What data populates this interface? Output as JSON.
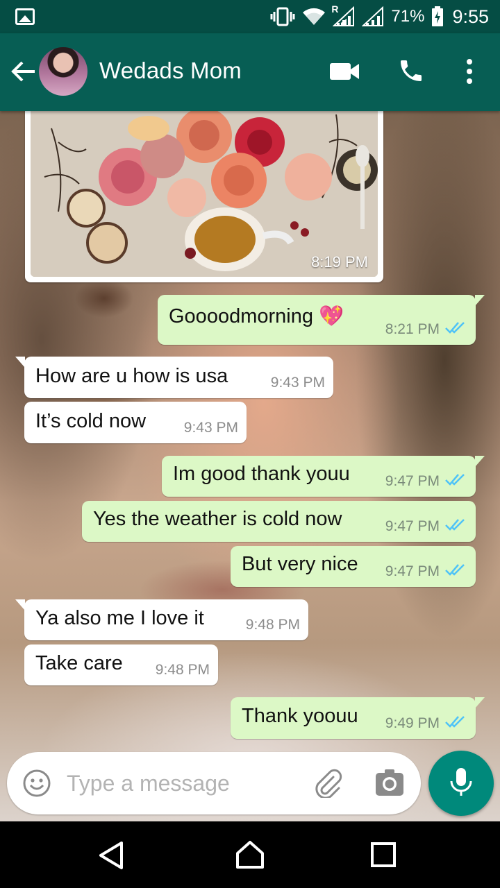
{
  "status_bar": {
    "battery": "71%",
    "time": "9:55",
    "icons": [
      "gallery-icon",
      "vibrate-icon",
      "wifi-icon",
      "signal-roaming-icon",
      "signal-icon",
      "battery-charging-icon"
    ],
    "roaming_label": "R"
  },
  "header": {
    "contact_name": "Wedads Mom",
    "icons": [
      "back-arrow-icon",
      "avatar",
      "video-call-icon",
      "phone-icon",
      "more-vert-icon"
    ],
    "background_color": "#075e54"
  },
  "messages": [
    {
      "type": "image",
      "direction": "in",
      "time": "8:19 PM"
    },
    {
      "direction": "out",
      "text": "Goooodmorning 💖",
      "time": "8:21 PM",
      "status": "read"
    },
    {
      "direction": "in",
      "text": "How are u how is usa",
      "time": "9:43 PM"
    },
    {
      "direction": "in",
      "text": "It’s cold now",
      "time": "9:43 PM"
    },
    {
      "direction": "out",
      "text": "Im good thank youu",
      "time": "9:47 PM",
      "status": "read"
    },
    {
      "direction": "out",
      "text": "Yes the weather is cold now",
      "time": "9:47 PM",
      "status": "read"
    },
    {
      "direction": "out",
      "text": "But very nice",
      "time": "9:47 PM",
      "status": "read"
    },
    {
      "direction": "in",
      "text": "Ya also me I love it",
      "time": "9:48 PM"
    },
    {
      "direction": "in",
      "text": "Take care",
      "time": "9:48 PM"
    },
    {
      "direction": "out",
      "text": "Thank yoouu",
      "time": "9:49 PM",
      "status": "read"
    }
  ],
  "input": {
    "placeholder": "Type a message",
    "icons": [
      "emoji-icon",
      "attach-icon",
      "camera-icon",
      "mic-icon"
    ]
  },
  "colors": {
    "outgoing_bubble": "#dcf8c6",
    "incoming_bubble": "#ffffff",
    "read_ticks": "#4fc3f7",
    "mic_button": "#00897b"
  },
  "nav_bar": {
    "icons": [
      "nav-back-icon",
      "nav-home-icon",
      "nav-recents-icon"
    ]
  }
}
